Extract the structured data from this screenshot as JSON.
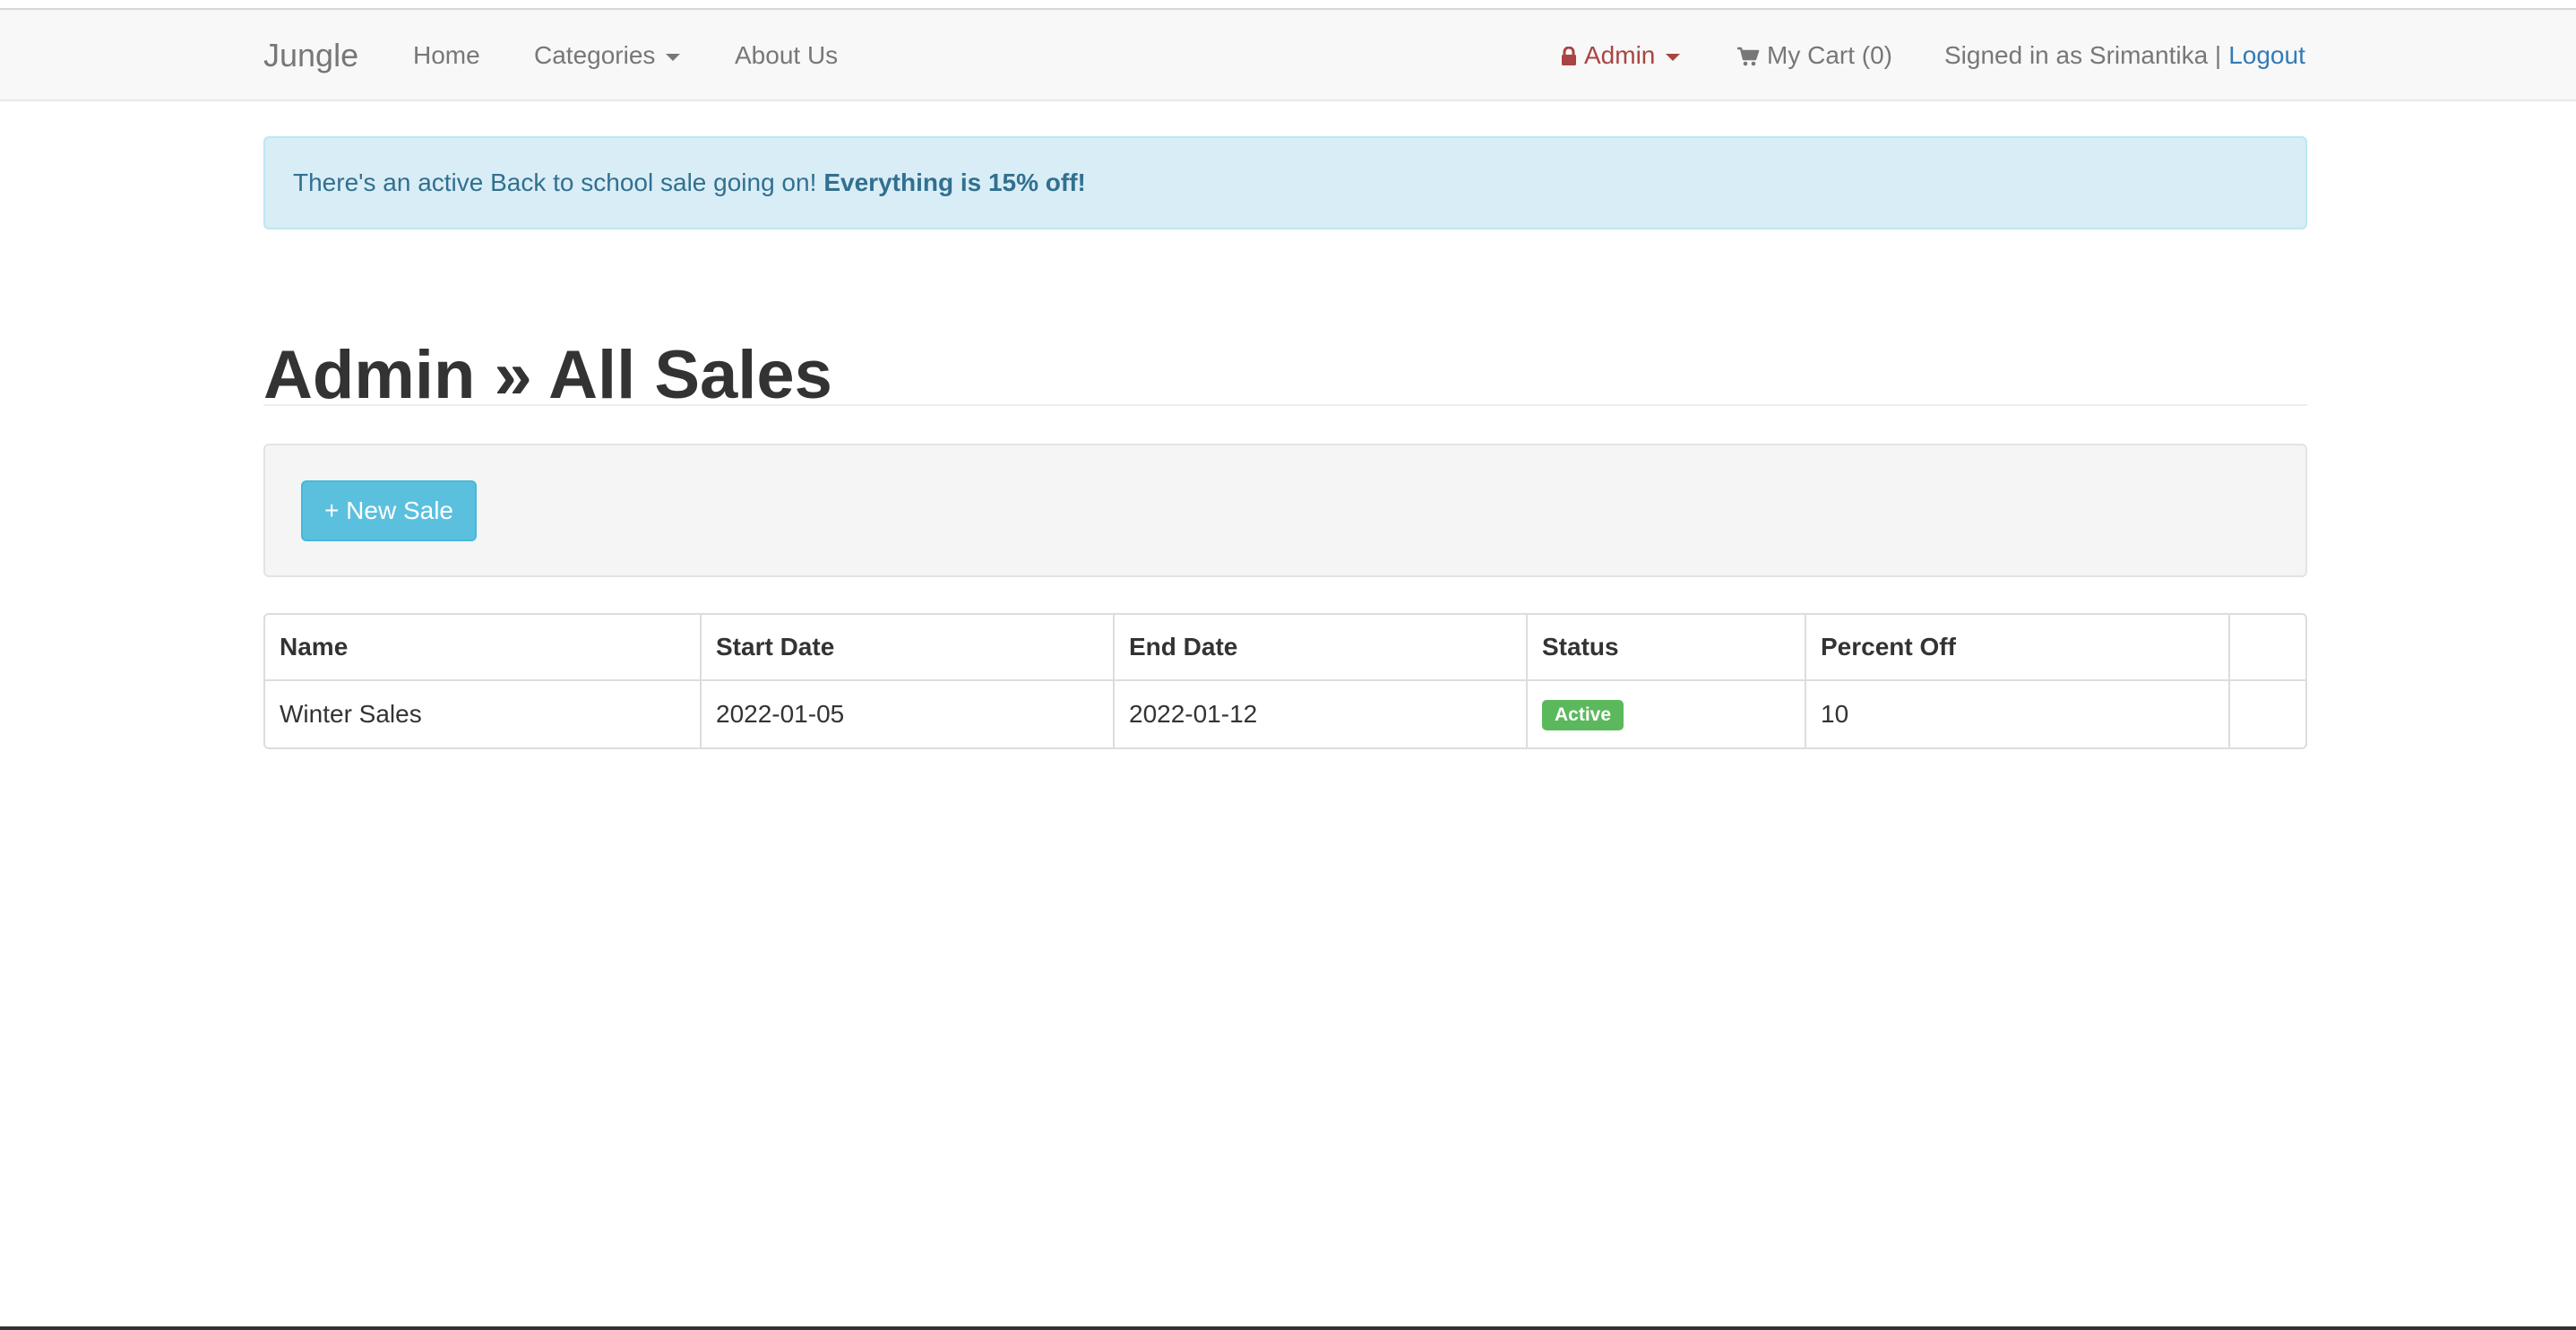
{
  "navbar": {
    "brand": "Jungle",
    "home": "Home",
    "categories": "Categories",
    "about": "About Us",
    "admin": "Admin",
    "cart": "My Cart (0)",
    "signed_in": "Signed in as Srimantika |",
    "logout": "Logout"
  },
  "alert": {
    "text": "There's an active Back to school sale going on!",
    "emphasis": "Everything is 15% off!"
  },
  "page": {
    "title": "Admin » All Sales"
  },
  "toolbar": {
    "new_sale_label": "+ New Sale"
  },
  "table": {
    "headers": [
      "Name",
      "Start Date",
      "End Date",
      "Status",
      "Percent Off",
      ""
    ],
    "rows": [
      {
        "name": "Winter Sales",
        "start_date": "2022-01-05",
        "end_date": "2022-01-12",
        "status": "Active",
        "percent_off": "10"
      }
    ]
  },
  "colors": {
    "status_active": "#5cb85c",
    "admin_link": "#a94442",
    "link": "#337ab7",
    "info_button": "#5bc0de"
  },
  "icons": [
    "lock-icon",
    "shopping-cart-icon",
    "caret-down-icon"
  ]
}
